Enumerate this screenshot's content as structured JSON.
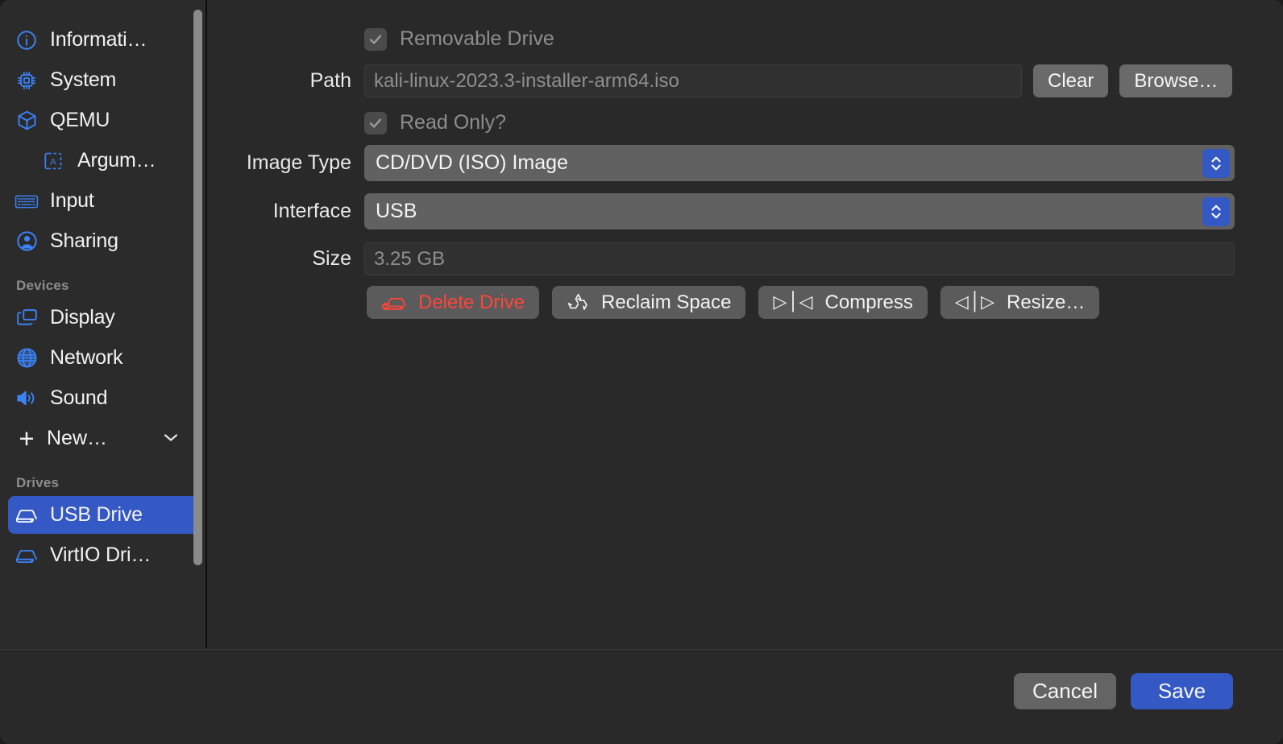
{
  "colors": {
    "accent": "#3458c4",
    "danger": "#ff453a",
    "window_bg": "#292929",
    "sidebar_bg": "#2b2b2b",
    "field_bg": "#303030",
    "button_bg": "#6a6a6a",
    "icon_blue": "#3b82f6"
  },
  "sidebar": {
    "items": [
      {
        "label": "Informati…",
        "icon": "info-circle-icon",
        "indent": false,
        "selected": false
      },
      {
        "label": "System",
        "icon": "cpu-chip-icon",
        "indent": false,
        "selected": false
      },
      {
        "label": "QEMU",
        "icon": "package-box-icon",
        "indent": false,
        "selected": false
      },
      {
        "label": "Argum…",
        "icon": "arguments-a-icon",
        "indent": true,
        "selected": false
      },
      {
        "label": "Input",
        "icon": "keyboard-icon",
        "indent": false,
        "selected": false
      },
      {
        "label": "Sharing",
        "icon": "person-circle-icon",
        "indent": false,
        "selected": false
      }
    ],
    "devices_group": "Devices",
    "devices": [
      {
        "label": "Display",
        "icon": "display-windows-icon",
        "indent": false,
        "selected": false
      },
      {
        "label": "Network",
        "icon": "globe-icon",
        "indent": false,
        "selected": false
      },
      {
        "label": "Sound",
        "icon": "speaker-wave-icon",
        "indent": false,
        "selected": false
      }
    ],
    "new_button": {
      "label": "New…",
      "plus": "+",
      "chevron": "chevron-down-icon"
    },
    "drives_group": "Drives",
    "drives": [
      {
        "label": "USB Drive",
        "icon": "drive-icon",
        "indent": false,
        "selected": true
      },
      {
        "label": "VirtIO Dri…",
        "icon": "drive-icon",
        "indent": false,
        "selected": false
      }
    ]
  },
  "form": {
    "removable_drive": {
      "label": "Removable Drive",
      "checked": true,
      "enabled": false
    },
    "path": {
      "label": "Path",
      "value": "kali-linux-2023.3-installer-arm64.iso",
      "clear_label": "Clear",
      "browse_label": "Browse…"
    },
    "read_only": {
      "label": "Read Only?",
      "checked": true,
      "enabled": false
    },
    "image_type": {
      "label": "Image Type",
      "value": "CD/DVD (ISO) Image"
    },
    "interface": {
      "label": "Interface",
      "value": "USB"
    },
    "size": {
      "label": "Size",
      "value": "3.25 GB"
    },
    "actions": [
      {
        "label": "Delete Drive",
        "icon": "drive-minus-icon",
        "danger": true
      },
      {
        "label": "Reclaim Space",
        "icon": "recycle-icon",
        "danger": false
      },
      {
        "label": "Compress",
        "icon": "compress-arrows-icon",
        "danger": false
      },
      {
        "label": "Resize…",
        "icon": "expand-arrows-icon",
        "danger": false
      }
    ]
  },
  "footer": {
    "cancel_label": "Cancel",
    "save_label": "Save"
  }
}
